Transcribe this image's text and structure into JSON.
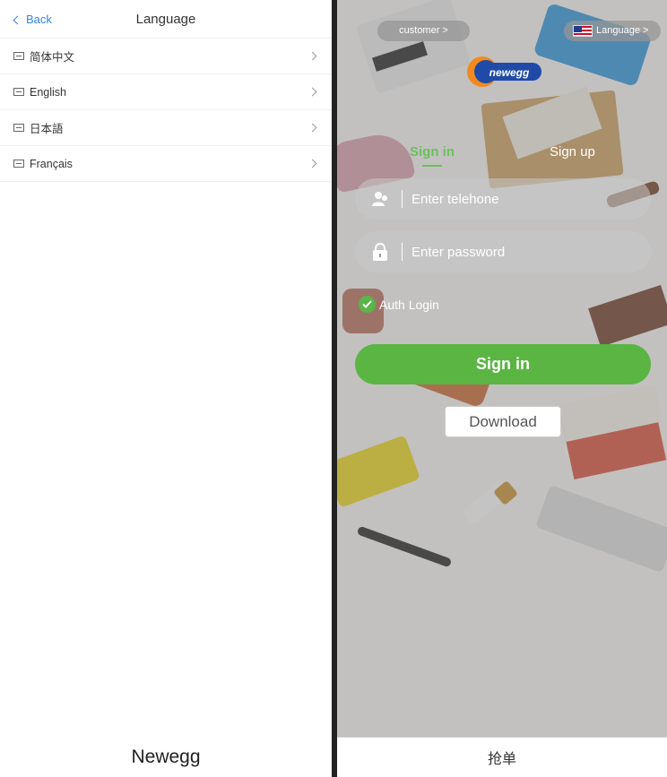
{
  "left": {
    "back_label": "Back",
    "title": "Language",
    "languages": [
      {
        "label": "简体中文"
      },
      {
        "label": "English"
      },
      {
        "label": "日本語"
      },
      {
        "label": "Français"
      }
    ],
    "footer": "Newegg"
  },
  "right": {
    "customer_label": "customer >",
    "language_label": "Language >",
    "logo_text": "newegg",
    "tabs": {
      "signin": "Sign in",
      "signup": "Sign up"
    },
    "phone_placeholder": "Enter telehone",
    "password_placeholder": "Enter password",
    "auth_label": "Auth Login",
    "signin_button": "Sign in",
    "download_button": "Download",
    "footer": "抢单"
  },
  "colors": {
    "accent_green": "#5ab543",
    "link_blue": "#2f86f6"
  }
}
